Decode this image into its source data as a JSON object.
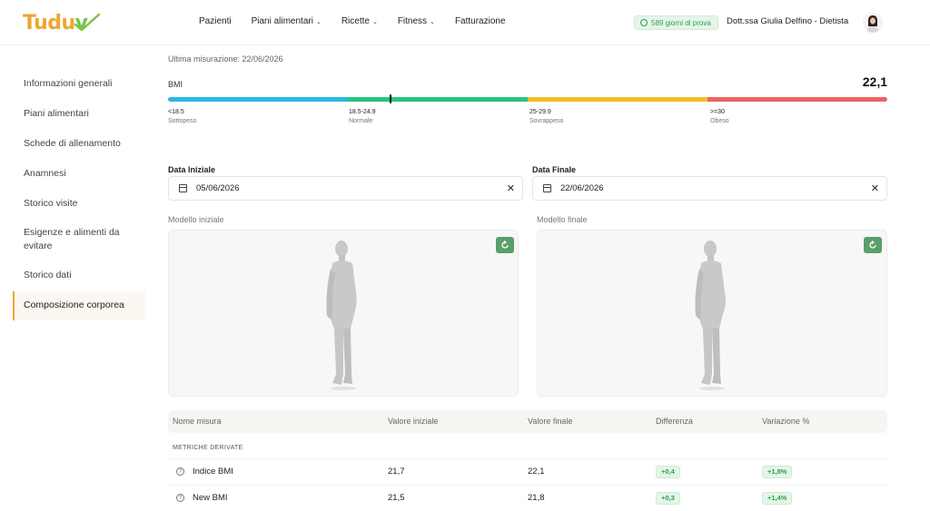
{
  "header": {
    "logo_text_primary": "Tudu",
    "logo_text_accent": "v",
    "nav": [
      {
        "label": "Pazienti",
        "dropdown": false
      },
      {
        "label": "Piani alimentari",
        "dropdown": true
      },
      {
        "label": "Ricette",
        "dropdown": true
      },
      {
        "label": "Fitness",
        "dropdown": true
      },
      {
        "label": "Fatturazione",
        "dropdown": false
      }
    ],
    "trial_badge": "589 giorni di prova",
    "user_name": "Dott.ssa Giulia Delfino - Dietista"
  },
  "sidebar": {
    "items": [
      {
        "label": "Informazioni generali",
        "active": false
      },
      {
        "label": "Piani alimentari",
        "active": false
      },
      {
        "label": "Schede di allenamento",
        "active": false
      },
      {
        "label": "Anamnesi",
        "active": false
      },
      {
        "label": "Storico visite",
        "active": false
      },
      {
        "label": "Esigenze e alimenti da evitare",
        "active": false
      },
      {
        "label": "Storico dati",
        "active": false
      },
      {
        "label": "Composizione corporea",
        "active": true
      }
    ]
  },
  "main": {
    "last_measurement": "Ultima misurazione: 22/06/2026",
    "bmi": {
      "label": "BMI",
      "value": "22,1",
      "ranges": [
        {
          "range": "<18.5",
          "category": "Sottopeso",
          "color": "#2cb6e6"
        },
        {
          "range": "18.5-24.9",
          "category": "Normale",
          "color": "#27c47e"
        },
        {
          "range": "25-29.9",
          "category": "Sovrappeso",
          "color": "#f0bd25"
        },
        {
          "range": ">=30",
          "category": "Obeso",
          "color": "#ec6367"
        }
      ]
    },
    "start_date": {
      "label": "Data Iniziale",
      "value": "05/06/2026"
    },
    "end_date": {
      "label": "Data Finale",
      "value": "22/06/2026"
    },
    "initial_model_label": "Modello iniziale",
    "final_model_label": "Modello finale",
    "table": {
      "headers": [
        "Nome misura",
        "Valore iniziale",
        "Valore finale",
        "Differenza",
        "Variazione %"
      ],
      "section": "METRICHE DERIVATE",
      "rows": [
        {
          "name": "Indice BMI",
          "initial": "21,7",
          "final": "22,1",
          "diff": "+0,4",
          "pct": "+1,8%"
        },
        {
          "name": "New BMI",
          "initial": "21,5",
          "final": "21,8",
          "diff": "+0,3",
          "pct": "+1,4%"
        }
      ]
    }
  },
  "colors": {
    "accent": "#f0a531",
    "success": "#2e9c4e",
    "reset_button": "#5a9e6b"
  }
}
